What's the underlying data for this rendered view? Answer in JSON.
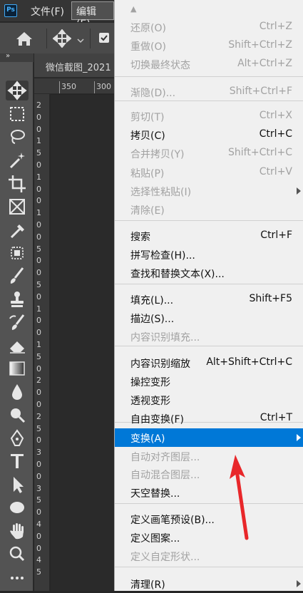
{
  "app": {
    "logo": "Ps"
  },
  "menubar": {
    "file": "文件(F)",
    "edit": "编辑(E)"
  },
  "document": {
    "tab": "微信截图_2021"
  },
  "ruler": {
    "h_labels": [
      "350",
      "300"
    ],
    "v_digits": [
      "2",
      "0",
      "0",
      "1",
      "5",
      "0",
      "1",
      "0",
      "0",
      "1",
      "0",
      "0",
      "5",
      "0",
      "0",
      "5",
      "0",
      "1",
      "0",
      "0",
      "1",
      "5",
      "0",
      "2",
      "0",
      "0",
      "2",
      "5",
      "0",
      "3",
      "0",
      "0",
      "3",
      "5",
      "0",
      "4",
      "0",
      "0",
      "4",
      "5"
    ]
  },
  "edit_menu": {
    "scroll_up": "▲",
    "items": [
      {
        "label": "还原(O)",
        "shortcut": "Ctrl+Z",
        "enabled": false
      },
      {
        "label": "重做(O)",
        "shortcut": "Shift+Ctrl+Z",
        "enabled": false
      },
      {
        "label": "切换最终状态",
        "shortcut": "Alt+Ctrl+Z",
        "enabled": false
      },
      {
        "label": "渐隐(D)...",
        "shortcut": "Shift+Ctrl+F",
        "enabled": false
      },
      {
        "label": "剪切(T)",
        "shortcut": "Ctrl+X",
        "enabled": false
      },
      {
        "label": "拷贝(C)",
        "shortcut": "Ctrl+C",
        "enabled": true
      },
      {
        "label": "合并拷贝(Y)",
        "shortcut": "Shift+Ctrl+C",
        "enabled": false
      },
      {
        "label": "粘贴(P)",
        "shortcut": "Ctrl+V",
        "enabled": false
      },
      {
        "label": "选择性粘贴(I)",
        "shortcut": "",
        "enabled": false,
        "submenu": true
      },
      {
        "label": "清除(E)",
        "shortcut": "",
        "enabled": false
      },
      {
        "label": "搜索",
        "shortcut": "Ctrl+F",
        "enabled": true
      },
      {
        "label": "拼写检查(H)...",
        "shortcut": "",
        "enabled": true
      },
      {
        "label": "查找和替换文本(X)...",
        "shortcut": "",
        "enabled": true
      },
      {
        "label": "填充(L)...",
        "shortcut": "Shift+F5",
        "enabled": true
      },
      {
        "label": "描边(S)...",
        "shortcut": "",
        "enabled": true
      },
      {
        "label": "内容识别填充...",
        "shortcut": "",
        "enabled": false
      },
      {
        "label": "内容识别缩放",
        "shortcut": "Alt+Shift+Ctrl+C",
        "enabled": true
      },
      {
        "label": "操控变形",
        "shortcut": "",
        "enabled": true
      },
      {
        "label": "透视变形",
        "shortcut": "",
        "enabled": true
      },
      {
        "label": "自由变换(F)",
        "shortcut": "Ctrl+T",
        "enabled": true
      },
      {
        "label": "变换(A)",
        "shortcut": "",
        "enabled": true,
        "submenu": true,
        "highlighted": true
      },
      {
        "label": "自动对齐图层...",
        "shortcut": "",
        "enabled": false
      },
      {
        "label": "自动混合图层...",
        "shortcut": "",
        "enabled": false
      },
      {
        "label": "天空替换...",
        "shortcut": "",
        "enabled": true
      },
      {
        "label": "定义画笔预设(B)...",
        "shortcut": "",
        "enabled": true
      },
      {
        "label": "定义图案...",
        "shortcut": "",
        "enabled": true
      },
      {
        "label": "定义自定形状...",
        "shortcut": "",
        "enabled": false
      },
      {
        "label": "清理(R)",
        "shortcut": "",
        "enabled": true,
        "submenu": true
      }
    ]
  },
  "colors": {
    "highlight": "#0078d7",
    "annotation_arrow": "#e8272a"
  }
}
